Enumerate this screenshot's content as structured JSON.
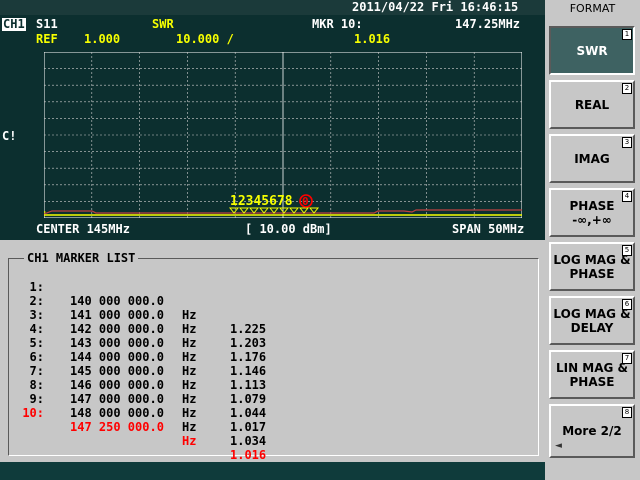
{
  "datetime": "2011/04/22 Fri 16:46:15",
  "display": {
    "channel": "CH1",
    "parameter": "S11",
    "format": "SWR",
    "marker_label": "MKR 10:",
    "marker_freq": "147.25MHz",
    "ref_label": "REF",
    "ref_value": "1.000",
    "scale": "10.000 /",
    "marker_value": "1.016",
    "cal_flag": "C!",
    "center": "CENTER 145MHz",
    "power": "[ 10.00 dBm]",
    "span": "SPAN 50MHz",
    "marker_tags": "12345678",
    "active_marker_tag": "0"
  },
  "colors": {
    "trace": "#f7ff00",
    "active_marker": "#ff0000",
    "grid": "#ffffff",
    "display_bg": "#0c2f2f"
  },
  "marker_list": {
    "title": "CH1 MARKER LIST",
    "rows": [
      {
        "num": "1:",
        "freq": "140 000 000.0",
        "unit": "Hz",
        "value": "1.225"
      },
      {
        "num": "2:",
        "freq": "141 000 000.0",
        "unit": "Hz",
        "value": "1.203"
      },
      {
        "num": "3:",
        "freq": "142 000 000.0",
        "unit": "Hz",
        "value": "1.176"
      },
      {
        "num": "4:",
        "freq": "143 000 000.0",
        "unit": "Hz",
        "value": "1.146"
      },
      {
        "num": "5:",
        "freq": "144 000 000.0",
        "unit": "Hz",
        "value": "1.113"
      },
      {
        "num": "6:",
        "freq": "145 000 000.0",
        "unit": "Hz",
        "value": "1.079"
      },
      {
        "num": "7:",
        "freq": "146 000 000.0",
        "unit": "Hz",
        "value": "1.044"
      },
      {
        "num": "8:",
        "freq": "147 000 000.0",
        "unit": "Hz",
        "value": "1.017"
      },
      {
        "num": "9:",
        "freq": "148 000 000.0",
        "unit": "Hz",
        "value": "1.034"
      },
      {
        "num": "10:",
        "freq": "147 250 000.0",
        "unit": "Hz",
        "value": "1.016"
      }
    ]
  },
  "softkeys": {
    "title": "FORMAT",
    "keys": [
      {
        "line1": "SWR",
        "line2": "",
        "num": "1"
      },
      {
        "line1": "REAL",
        "line2": "",
        "num": "2"
      },
      {
        "line1": "IMAG",
        "line2": "",
        "num": "3"
      },
      {
        "line1": "PHASE",
        "line2": "-∞,+∞",
        "num": "4"
      },
      {
        "line1": "LOG MAG &",
        "line2": "PHASE",
        "num": "5"
      },
      {
        "line1": "LOG MAG &",
        "line2": "DELAY",
        "num": "6"
      },
      {
        "line1": "LIN MAG &",
        "line2": "PHASE",
        "num": "7"
      },
      {
        "line1": "More 2/2",
        "line2": "",
        "num": "8"
      }
    ]
  }
}
